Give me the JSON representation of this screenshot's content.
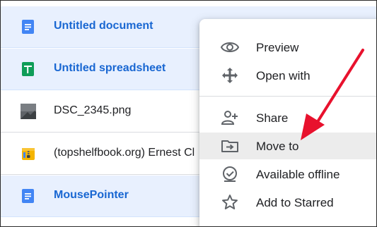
{
  "files": [
    {
      "name": "Untitled document",
      "icon": "google-docs-icon",
      "selected": true
    },
    {
      "name": "Untitled spreadsheet",
      "icon": "google-sheets-icon",
      "selected": true
    },
    {
      "name": "DSC_2345.png",
      "icon": "image-thumbnail-icon",
      "selected": false
    },
    {
      "name": "(topshelfbook.org) Ernest Cl",
      "icon": "zip-archive-icon",
      "selected": false
    },
    {
      "name": "MousePointer",
      "icon": "google-docs-icon",
      "selected": true
    }
  ],
  "context_menu": {
    "items": [
      {
        "label": "Preview",
        "icon": "eye-icon"
      },
      {
        "label": "Open with",
        "icon": "move-arrows-icon"
      },
      {
        "label": "Share",
        "icon": "add-person-icon"
      },
      {
        "label": "Move to",
        "icon": "folder-move-icon",
        "highlighted": true
      },
      {
        "label": "Available offline",
        "icon": "offline-check-icon"
      },
      {
        "label": "Add to Starred",
        "icon": "star-outline-icon"
      }
    ]
  },
  "colors": {
    "accent": "#1967d2",
    "selected_row": "#e8f0fe",
    "docs_blue": "#4285f4",
    "sheets_green": "#0f9d58",
    "arrow_red": "#e8112d"
  }
}
